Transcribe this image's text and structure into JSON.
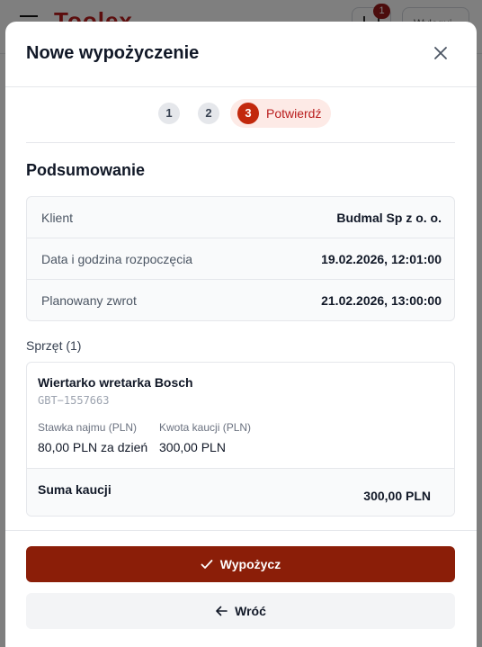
{
  "background": {
    "logo_text": "Toolex",
    "cart_count": "1",
    "header_button": "Wyloguj"
  },
  "modal": {
    "title": "Nowe wypożyczenie",
    "close_icon": "close-icon"
  },
  "stepper": {
    "steps": [
      {
        "number": "1"
      },
      {
        "number": "2"
      },
      {
        "number": "3",
        "label": "Potwierdź"
      }
    ],
    "active_index": 3
  },
  "summary": {
    "title": "Podsumowanie",
    "rows": [
      {
        "label": "Klient",
        "value": "Budmal Sp z o. o."
      },
      {
        "label": "Data i godzina rozpoczęcia",
        "value": "19.02.2026, 12:01:00"
      },
      {
        "label": "Planowany zwrot",
        "value": "21.02.2026, 13:00:00"
      }
    ]
  },
  "equipment": {
    "section_label": "Sprzęt (1)",
    "items": [
      {
        "name": "Wiertarko wretarka Bosch",
        "code": "GBT−1557663",
        "rate_label": "Stawka najmu (PLN)",
        "rate_value": "80,00 PLN za dzień",
        "deposit_label": "Kwota kaucji (PLN)",
        "deposit_value": "300,00 PLN"
      }
    ],
    "total_label": "Suma kaucji",
    "total_value": "300,00 PLN"
  },
  "footer": {
    "primary_label": "Wypożycz",
    "primary_icon": "check-icon",
    "secondary_label": "Wróć",
    "secondary_icon": "arrow-left-icon"
  },
  "colors": {
    "primary": "#8b1e08",
    "accent": "#c2290d",
    "accent_bg": "#fdeae6"
  }
}
